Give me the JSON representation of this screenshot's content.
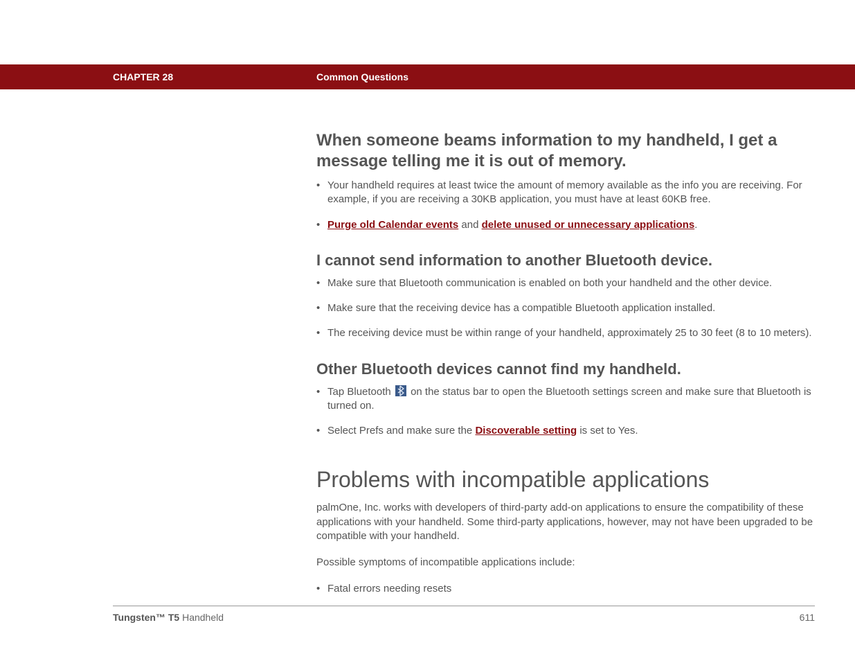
{
  "header": {
    "chapter": "CHAPTER 28",
    "section": "Common Questions"
  },
  "q1": {
    "heading": "When someone beams information to my handheld, I get a message telling me it is out of memory.",
    "bullet1": "Your handheld requires at least twice the amount of memory available as the info you are receiving. For example, if you are receiving a 30KB application, you must have at least 60KB free.",
    "bullet2_link1": "Purge old Calendar events",
    "bullet2_mid": " and ",
    "bullet2_link2": "delete unused or unnecessary applications",
    "bullet2_end": "."
  },
  "q2": {
    "heading": "I cannot send information to another Bluetooth device.",
    "bullet1": "Make sure that Bluetooth communication is enabled on both your handheld and the other device.",
    "bullet2": "Make sure that the receiving device has a compatible Bluetooth application installed.",
    "bullet3": "The receiving device must be within range of your handheld, approximately 25 to 30 feet (8 to 10 meters)."
  },
  "q3": {
    "heading": "Other Bluetooth devices cannot find my handheld.",
    "bullet1_pre": "Tap Bluetooth ",
    "bullet1_post": " on the status bar to open the Bluetooth settings screen and make sure that Bluetooth is turned on.",
    "bullet2_pre": "Select Prefs and make sure the ",
    "bullet2_link": "Discoverable setting",
    "bullet2_post": " is set to Yes."
  },
  "problems": {
    "heading": "Problems with incompatible applications",
    "para1": "palmOne, Inc. works with developers of third-party add-on applications to ensure the compatibility of these applications with your handheld. Some third-party applications, however, may not have been upgraded to be compatible with your handheld.",
    "para2": "Possible symptoms of incompatible applications include:",
    "bullet1": "Fatal errors needing resets"
  },
  "footer": {
    "product_bold": "Tungsten™ T5",
    "product_tail": " Handheld",
    "page": "611"
  }
}
